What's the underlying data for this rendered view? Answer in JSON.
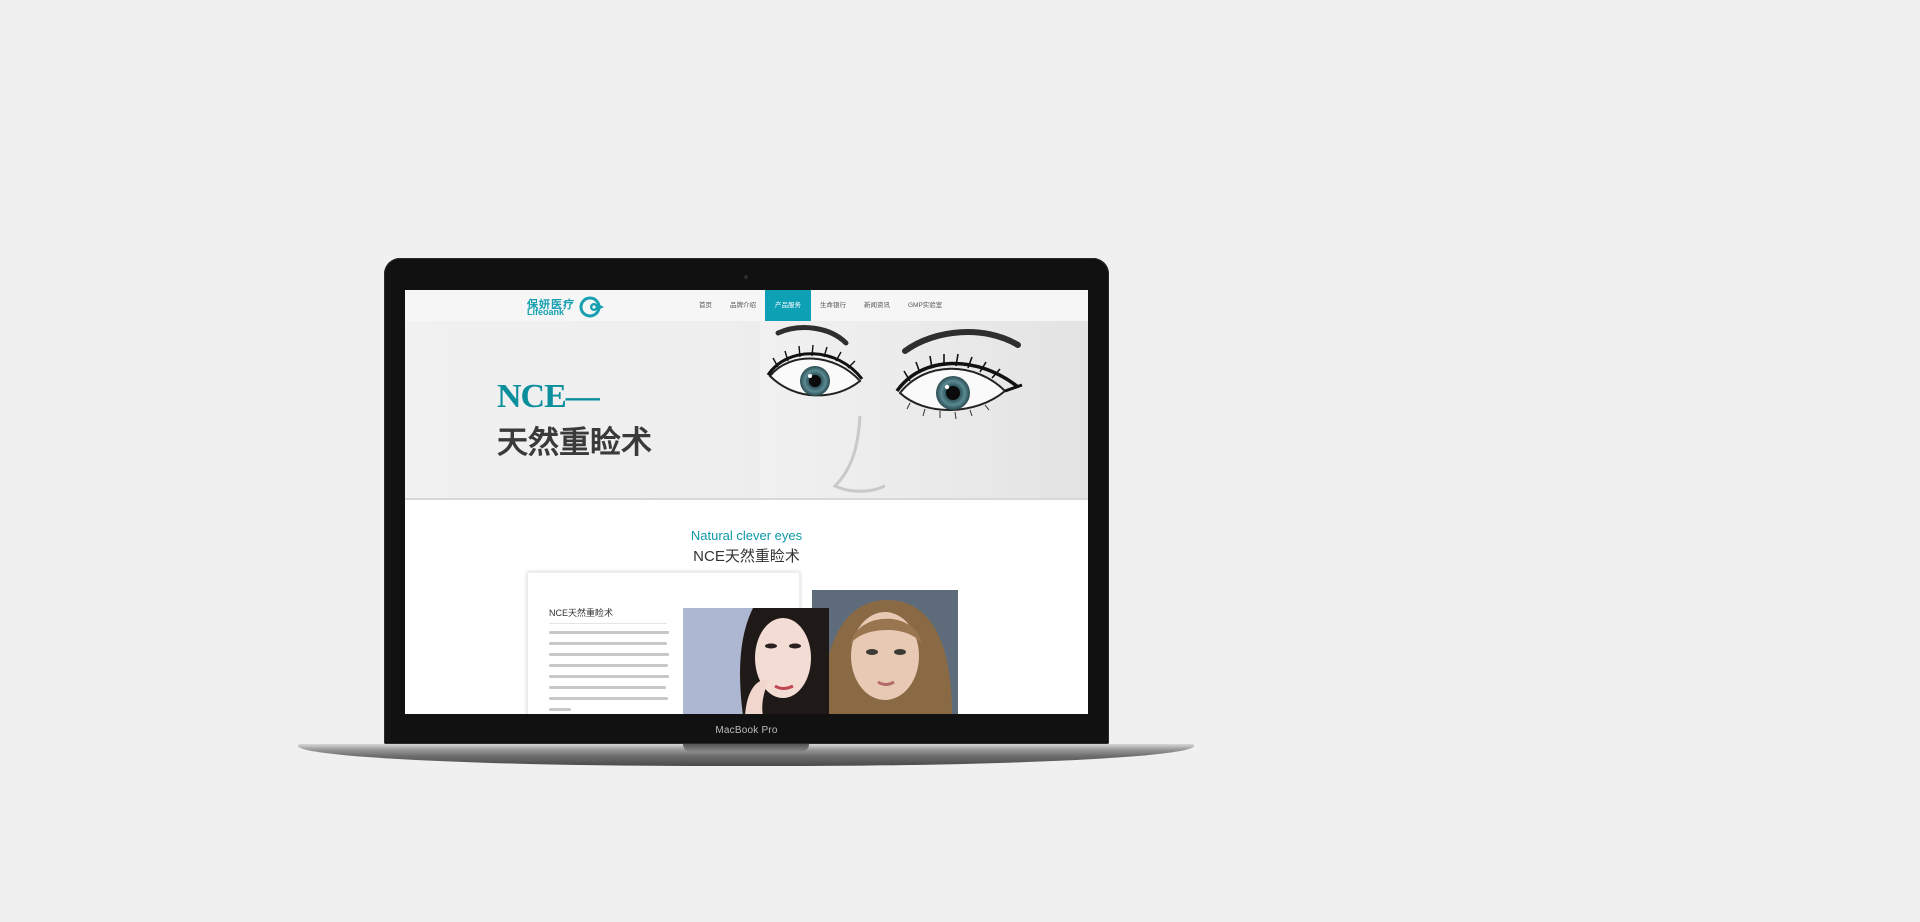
{
  "device": {
    "label": "MacBook Pro"
  },
  "site": {
    "logo": {
      "cn": "保妍医疗",
      "en": "Lifeoank"
    },
    "nav": {
      "items": [
        {
          "label": "首页"
        },
        {
          "label": "品牌介绍"
        },
        {
          "label": "产品服务",
          "active": true
        },
        {
          "label": "生命银行"
        },
        {
          "label": "新闻资讯"
        },
        {
          "label": "GMP实验室"
        }
      ]
    },
    "banner": {
      "title_line1": "NCE—",
      "title_line2": "天然重睑术"
    },
    "section": {
      "title_en": "Natural clever eyes",
      "title_cn": "NCE天然重睑术"
    },
    "card": {
      "title": "NCE天然重睑术"
    }
  },
  "colors": {
    "accent": "#0ea0b5",
    "background": "#f0f0f0"
  }
}
